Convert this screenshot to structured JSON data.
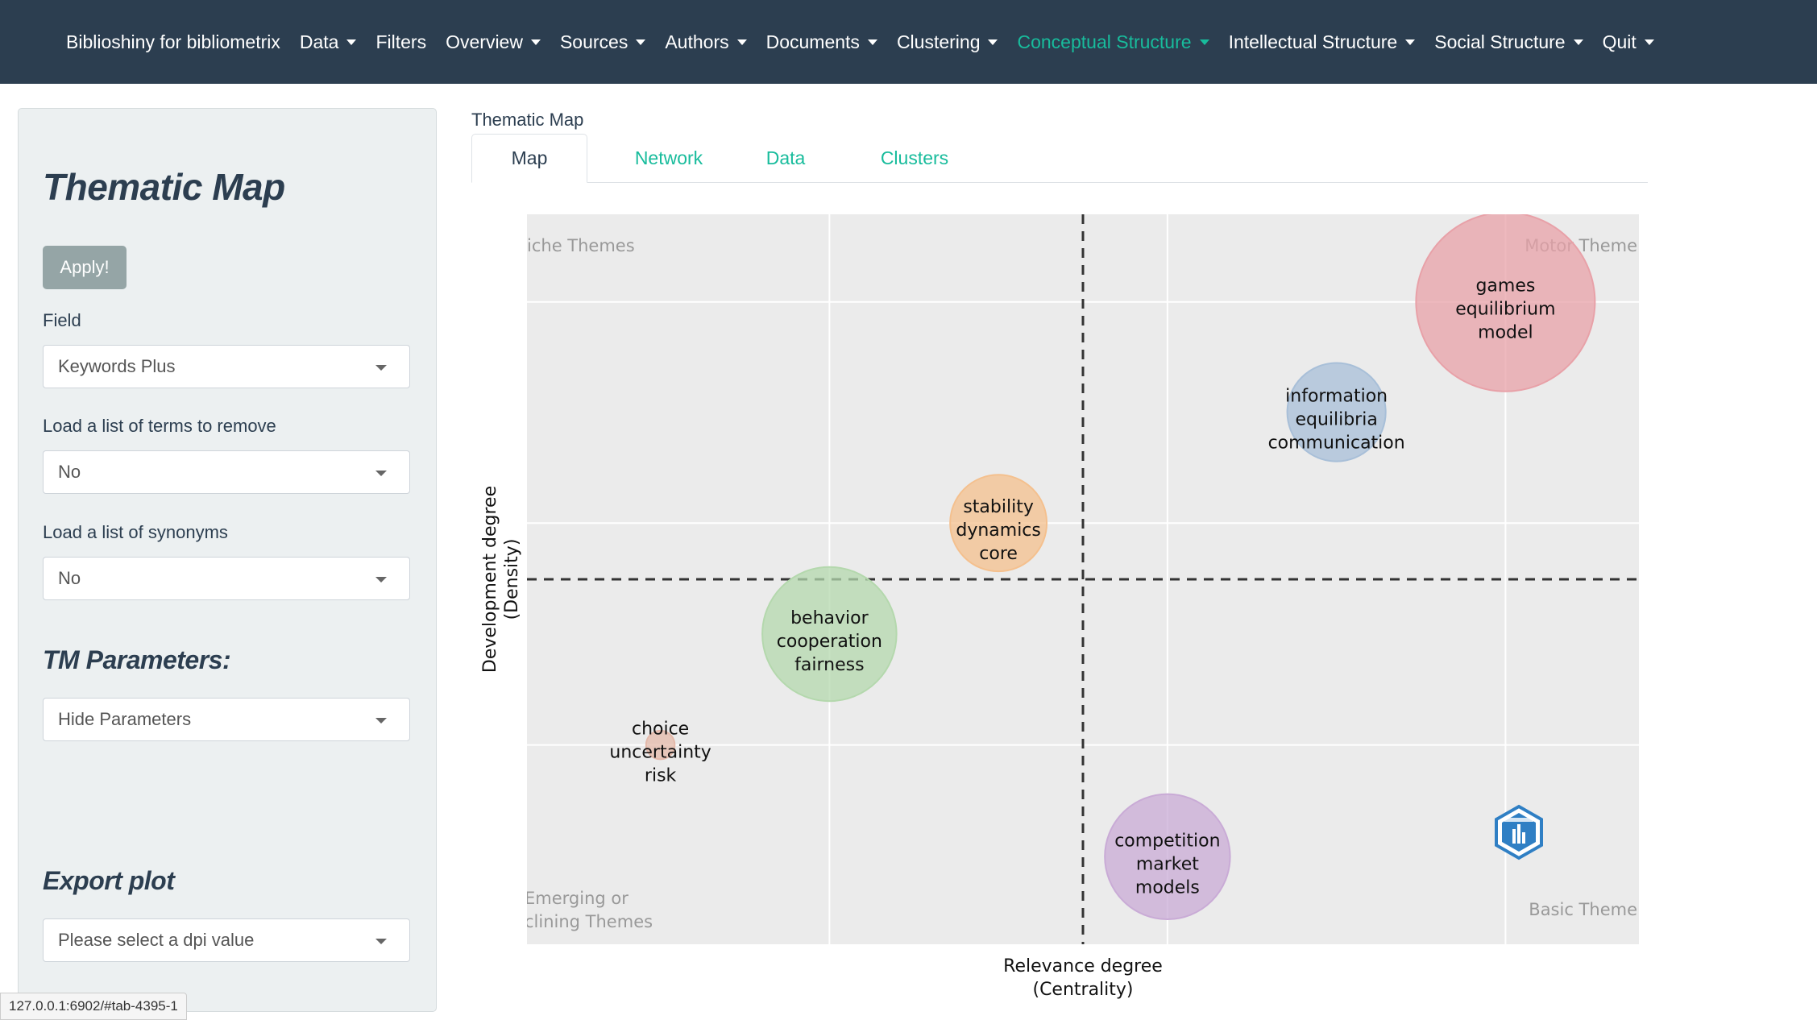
{
  "navbar": {
    "brand": "Biblioshiny for bibliometrix",
    "items": [
      {
        "label": "Data",
        "dropdown": true,
        "active": false
      },
      {
        "label": "Filters",
        "dropdown": false,
        "active": false
      },
      {
        "label": "Overview",
        "dropdown": true,
        "active": false
      },
      {
        "label": "Sources",
        "dropdown": true,
        "active": false
      },
      {
        "label": "Authors",
        "dropdown": true,
        "active": false
      },
      {
        "label": "Documents",
        "dropdown": true,
        "active": false
      },
      {
        "label": "Clustering",
        "dropdown": true,
        "active": false
      },
      {
        "label": "Conceptual Structure",
        "dropdown": true,
        "active": true
      },
      {
        "label": "Intellectual Structure",
        "dropdown": true,
        "active": false
      },
      {
        "label": "Social Structure",
        "dropdown": true,
        "active": false
      },
      {
        "label": "Quit",
        "dropdown": true,
        "active": false
      }
    ]
  },
  "sidebar": {
    "title": "Thematic Map",
    "apply_label": "Apply!",
    "field_label": "Field",
    "field_value": "Keywords Plus",
    "remove_label": "Load a list of terms to remove",
    "remove_value": "No",
    "synonyms_label": "Load a list of synonyms",
    "synonyms_value": "No",
    "params_title": "TM Parameters:",
    "params_value": "Hide Parameters",
    "export_title": "Export plot",
    "dpi_placeholder": "Please select a dpi value"
  },
  "main": {
    "title": "Thematic Map",
    "tabs": [
      "Map",
      "Network",
      "Data",
      "Clusters"
    ]
  },
  "chart_data": {
    "type": "scatter",
    "xlabel": "Relevance degree\n(Centrality)",
    "ylabel": "Development degree\n(Density)",
    "quadrant_labels": {
      "top_left": "iche Themes",
      "top_right": "Motor Theme",
      "bottom_left": "Emerging or\nclining Themes",
      "bottom_right": "Basic Theme"
    },
    "x_ref": 0.5,
    "y_ref": 0.5,
    "points": [
      {
        "labels": [
          "games",
          "equilibrium",
          "model"
        ],
        "x": 0.88,
        "y": 0.88,
        "size": 1.0,
        "color": "#e8a1a8"
      },
      {
        "labels": [
          "information",
          "equilibria",
          "communication"
        ],
        "x": 0.728,
        "y": 0.729,
        "size": 0.55,
        "color": "#a8bfd8"
      },
      {
        "labels": [
          "stability",
          "dynamics",
          "core"
        ],
        "x": 0.424,
        "y": 0.577,
        "size": 0.54,
        "color": "#f4c08e"
      },
      {
        "labels": [
          "behavior",
          "cooperation",
          "fairness"
        ],
        "x": 0.272,
        "y": 0.425,
        "size": 0.75,
        "color": "#b4d8ad"
      },
      {
        "labels": [
          "choice",
          "uncertainty",
          "risk"
        ],
        "x": 0.12,
        "y": 0.273,
        "size": 0.16,
        "color": "#e4b9aa"
      },
      {
        "labels": [
          "competition",
          "market",
          "models"
        ],
        "x": 0.576,
        "y": 0.12,
        "size": 0.7,
        "color": "#c9abd6"
      }
    ],
    "grid": true,
    "colors": {
      "panel": "#ebebeb",
      "grid": "#ffffff",
      "refline": "#333333"
    }
  },
  "status": {
    "url": "127.0.0.1:6902/#tab-4395-1"
  }
}
